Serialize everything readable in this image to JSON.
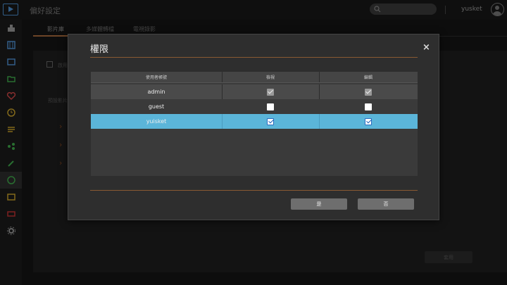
{
  "app": {
    "title": "偏好設定",
    "username": "yusket"
  },
  "search": {
    "placeholder": ""
  },
  "tabs": [
    {
      "label": "影片庫"
    },
    {
      "label": "多媒體轉檔"
    },
    {
      "label": "電視錄影"
    }
  ],
  "background": {
    "checkbox_label": "啟用",
    "section_label": "預設影片",
    "apply_label": "套用"
  },
  "dialog": {
    "title": "權限",
    "close": "×",
    "columns": [
      "使用者帳號",
      "檢視",
      "編輯"
    ],
    "rows": [
      {
        "user": "admin",
        "view": true,
        "edit": true,
        "disabled": true,
        "selected": false
      },
      {
        "user": "guest",
        "view": false,
        "edit": false,
        "disabled": false,
        "selected": false
      },
      {
        "user": "yuisket",
        "view": true,
        "edit": true,
        "disabled": false,
        "selected": true
      }
    ],
    "ok_label": "是",
    "cancel_label": "否"
  },
  "colors": {
    "accent": "#a86a3c",
    "selected_row": "#5bb5d9",
    "logo": "#4d8fd0"
  }
}
